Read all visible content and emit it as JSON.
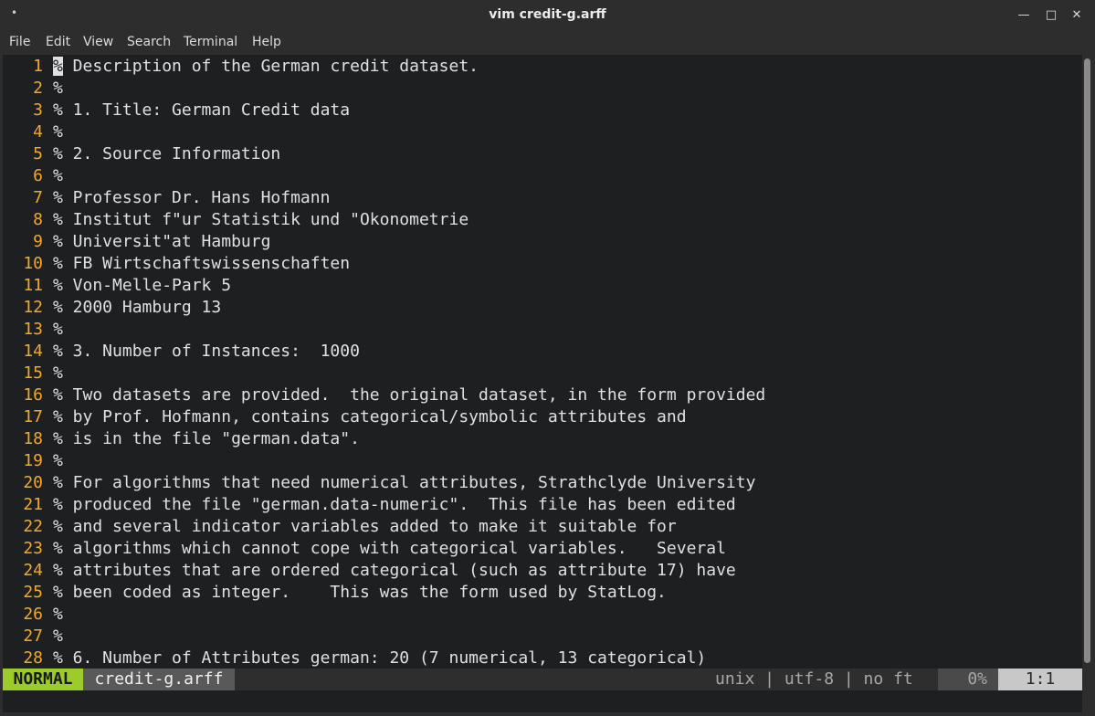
{
  "window": {
    "title": "vim credit-g.arff",
    "app_icon": "•",
    "minimize_glyph": "—",
    "maximize_glyph": "□",
    "close_glyph": "✕"
  },
  "menu": {
    "items": [
      "File",
      "Edit",
      "View",
      "Search",
      "Terminal",
      "Help"
    ]
  },
  "editor": {
    "line_numbers": [
      "1",
      "2",
      "3",
      "4",
      "5",
      "6",
      "7",
      "8",
      "9",
      "10",
      "11",
      "12",
      "13",
      "14",
      "15",
      "16",
      "17",
      "18",
      "19",
      "20",
      "21",
      "22",
      "23",
      "24",
      "25",
      "26",
      "27",
      "28"
    ],
    "cursor_char": "%",
    "first_line_rest": " Description of the German credit dataset.",
    "lines": [
      "% Description of the German credit dataset.",
      "%",
      "% 1. Title: German Credit data",
      "%",
      "% 2. Source Information",
      "%",
      "% Professor Dr. Hans Hofmann",
      "% Institut f\"ur Statistik und \"Okonometrie",
      "% Universit\"at Hamburg",
      "% FB Wirtschaftswissenschaften",
      "% Von-Melle-Park 5",
      "% 2000 Hamburg 13",
      "%",
      "% 3. Number of Instances:  1000",
      "%",
      "% Two datasets are provided.  the original dataset, in the form provided",
      "% by Prof. Hofmann, contains categorical/symbolic attributes and",
      "% is in the file \"german.data\".",
      "%",
      "% For algorithms that need numerical attributes, Strathclyde University",
      "% produced the file \"german.data-numeric\".  This file has been edited",
      "% and several indicator variables added to make it suitable for",
      "% algorithms which cannot cope with categorical variables.   Several",
      "% attributes that are ordered categorical (such as attribute 17) have",
      "% been coded as integer.    This was the form used by StatLog.",
      "%",
      "%",
      "% 6. Number of Attributes german: 20 (7 numerical, 13 categorical)"
    ]
  },
  "statusline": {
    "mode": "NORMAL",
    "filename": "credit-g.arff",
    "fileinfo": "unix | utf-8 | no ft",
    "percent": "0%",
    "position": "1:1"
  },
  "colors": {
    "line_number": "#f0a830",
    "mode_bg": "#9ccc2c",
    "background": "#1d1f21"
  }
}
